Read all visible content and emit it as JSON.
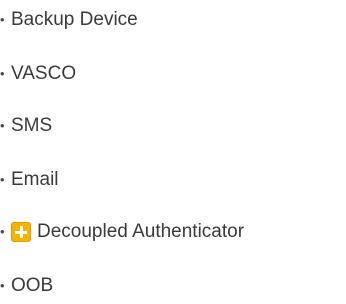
{
  "list": {
    "bullet": "•",
    "items": [
      {
        "label": "Backup Device"
      },
      {
        "label": "VASCO"
      },
      {
        "label": "SMS"
      },
      {
        "label": "Email"
      },
      {
        "label": "Decoupled Authenticator",
        "icon": "add-icon",
        "icon_color": "#f6b400"
      },
      {
        "label": "OOB"
      }
    ]
  }
}
